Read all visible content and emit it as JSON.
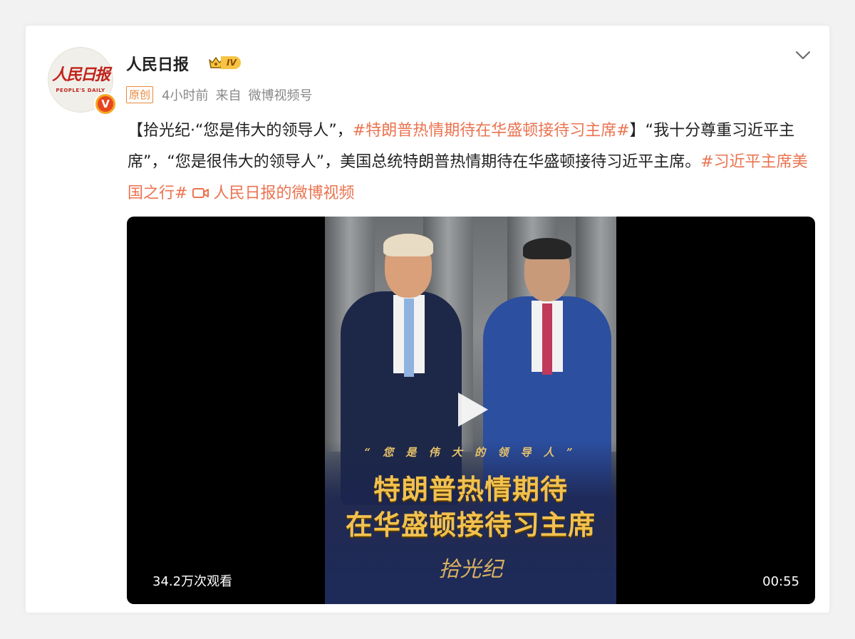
{
  "account": {
    "name": "人民日报",
    "level": "IV",
    "avatar_text_cn": "人民日报",
    "avatar_text_en": "PEOPLE'S DAILY",
    "verified_mark": "V"
  },
  "meta": {
    "original_tag": "原创",
    "time": "4小时前",
    "source_prefix": "来自",
    "source": "微博视频号"
  },
  "post": {
    "seg1": "【拾光纪·“您是伟大的领导人”，",
    "tag1": "#特朗普热情期待在华盛顿接待习主席#",
    "seg2": "】“我十分尊重习近平主席”，“您是很伟大的领导人”，美国总统特朗普热情期待在华盛顿接待习近平主席。",
    "tag2": "#习近平主席美国之行#",
    "video_link": "人民日报的微博视频"
  },
  "video": {
    "poster_quote": "“ 您 是 伟 大 的 领 导 人 ”",
    "headline_line1": "特朗普热情期待",
    "headline_line2": "在华盛顿接待习主席",
    "brand": "拾光纪",
    "views": "34.2万次观看",
    "duration": "00:55"
  },
  "icons": [
    "crown-icon",
    "chevron-down-icon",
    "video-camera-icon",
    "play-icon",
    "verified-icon"
  ],
  "colors": {
    "tag": "#eb7350",
    "original_tag_border": "#e8893b",
    "headline_gold": "#f2c14e",
    "verified": "#e8451f"
  }
}
